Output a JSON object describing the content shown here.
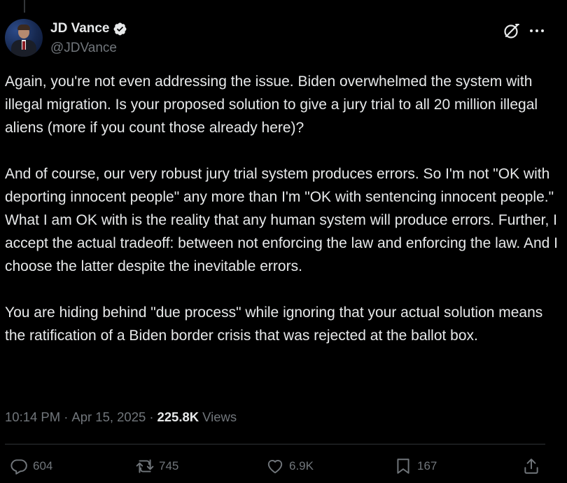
{
  "author": {
    "display_name": "JD Vance",
    "handle": "@JDVance",
    "verified": true
  },
  "tweet": {
    "paragraphs": [
      "Again, you're not even addressing the issue. Biden overwhelmed the system with illegal migration. Is your proposed solution to give a jury trial to all 20 million illegal aliens (more if you count those already here)?",
      "And of course, our very robust jury trial system produces errors. So I'm not \"OK with deporting innocent people\" any more than I'm \"OK with sentencing innocent people.\" What I am OK with is the reality that any human system will produce errors. Further, I accept the actual tradeoff: between not enforcing the law and enforcing the law. And I choose the latter despite the inevitable errors.",
      "You are hiding behind \"due process\" while ignoring that your actual solution means the ratification of a Biden border crisis that was rejected at the ballot box."
    ],
    "time": "10:14 PM",
    "separator": "·",
    "date": "Apr 15, 2025",
    "views_count": "225.8K",
    "views_label": "Views"
  },
  "actions": {
    "replies": "604",
    "reposts": "745",
    "likes": "6.9K",
    "bookmarks": "167"
  },
  "colors": {
    "background": "#000000",
    "text": "#e7e9ea",
    "secondary": "#71767b",
    "verified_badge": "#1d9bf0",
    "divider": "#2f3336"
  },
  "icons": {
    "verified": "verified-badge-icon",
    "grok": "grok-icon",
    "more": "more-icon",
    "reply": "reply-icon",
    "repost": "repost-icon",
    "like": "like-icon",
    "bookmark": "bookmark-icon",
    "share": "share-icon"
  }
}
